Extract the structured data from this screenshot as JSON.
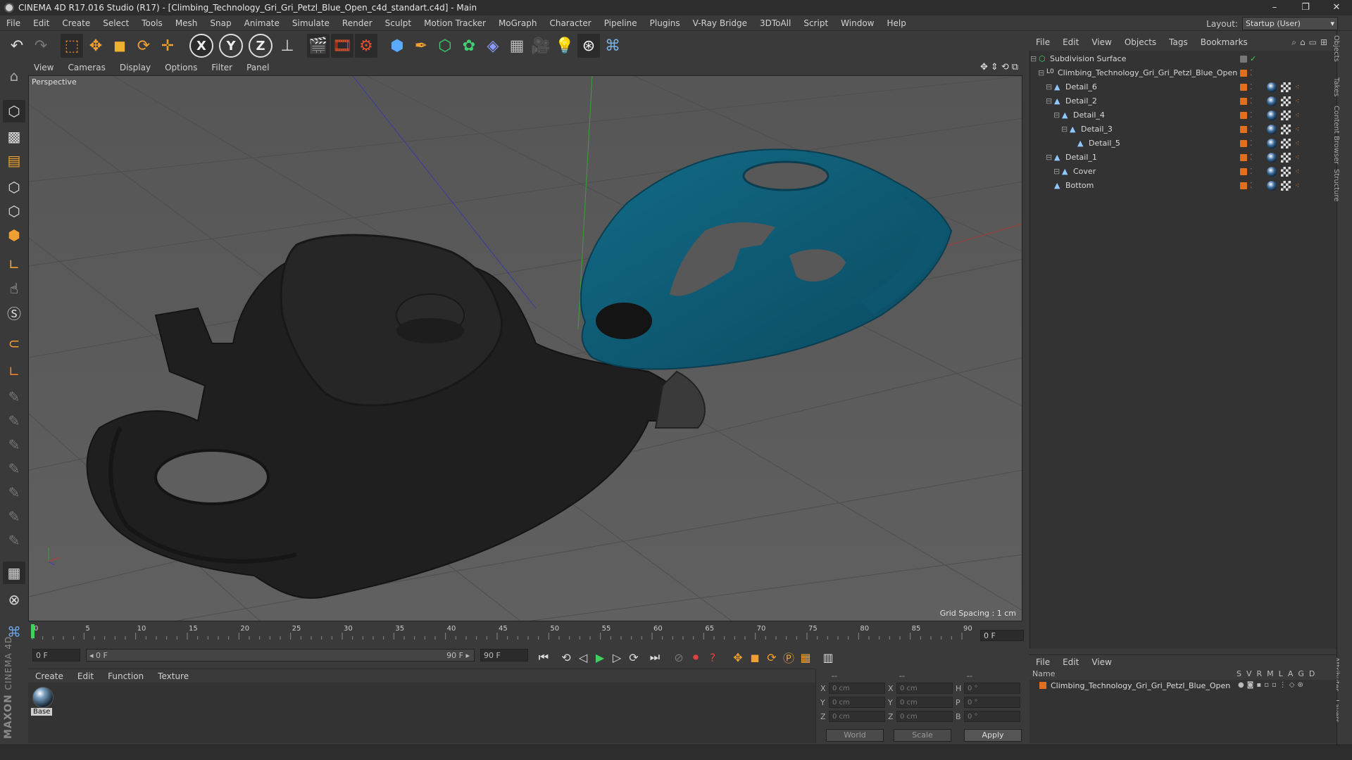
{
  "window": {
    "title": "CINEMA 4D R17.016 Studio (R17) - [Climbing_Technology_Gri_Gri_Petzl_Blue_Open_c4d_standart.c4d] - Main",
    "minimize": "–",
    "restore": "❐",
    "close": "✕"
  },
  "menu": [
    "File",
    "Edit",
    "Create",
    "Select",
    "Tools",
    "Mesh",
    "Snap",
    "Animate",
    "Simulate",
    "Render",
    "Sculpt",
    "Motion Tracker",
    "MoGraph",
    "Character",
    "Pipeline",
    "Plugins",
    "V-Ray Bridge",
    "3DToAll",
    "Script",
    "Window",
    "Help"
  ],
  "layout": {
    "label": "Layout:",
    "value": "Startup (User)"
  },
  "toolbar": {
    "x_label": "X",
    "y_label": "Y",
    "z_label": "Z"
  },
  "viewport": {
    "menu": [
      "View",
      "Cameras",
      "Display",
      "Options",
      "Filter",
      "Panel"
    ],
    "label": "Perspective",
    "grid_spacing": "Grid Spacing : 1 cm",
    "nav_icons": "✥⇕⟲⧉"
  },
  "timeline": {
    "ticks": [
      "0",
      "5",
      "10",
      "15",
      "20",
      "25",
      "30",
      "35",
      "40",
      "45",
      "50",
      "55",
      "60",
      "65",
      "70",
      "75",
      "80",
      "85",
      "90"
    ],
    "end_frame_box": "0 F"
  },
  "playback": {
    "start_field": "0 F",
    "range_start": "◂ 0 F",
    "range_end": "90 F ▸",
    "end_field": "90 F"
  },
  "material_manager": {
    "menu": [
      "Create",
      "Edit",
      "Function",
      "Texture"
    ],
    "material_name": "Base"
  },
  "maxon": {
    "brand": "MAXON",
    "product": "CINEMA 4D"
  },
  "coordinates": {
    "header_left": "--",
    "header_mid": "--",
    "header_right": "--",
    "rows": [
      {
        "a": "X",
        "av": "0 cm",
        "b": "X",
        "bv": "0 cm",
        "c": "H",
        "cv": "0 °"
      },
      {
        "a": "Y",
        "av": "0 cm",
        "b": "Y",
        "bv": "0 cm",
        "c": "P",
        "cv": "0 °"
      },
      {
        "a": "Z",
        "av": "0 cm",
        "b": "Z",
        "bv": "0 cm",
        "c": "B",
        "cv": "0 °"
      }
    ],
    "world": "World",
    "scale": "Scale",
    "apply": "Apply"
  },
  "object_manager": {
    "menu": [
      "File",
      "Edit",
      "View",
      "Objects",
      "Tags",
      "Bookmarks"
    ],
    "objects": [
      {
        "name": "Subdivision Surface",
        "level": 0,
        "icon": "subdivision-icon"
      },
      {
        "name": "Climbing_Technology_Gri_Gri_Petzl_Blue_Open",
        "level": 1,
        "icon": "null-icon"
      },
      {
        "name": "Detail_6",
        "level": 2,
        "icon": "polygon-icon"
      },
      {
        "name": "Detail_2",
        "level": 2,
        "icon": "polygon-icon"
      },
      {
        "name": "Detail_4",
        "level": 3,
        "icon": "polygon-icon"
      },
      {
        "name": "Detail_3",
        "level": 4,
        "icon": "polygon-icon"
      },
      {
        "name": "Detail_5",
        "level": 5,
        "icon": "polygon-icon"
      },
      {
        "name": "Detail_1",
        "level": 2,
        "icon": "polygon-icon"
      },
      {
        "name": "Cover",
        "level": 3,
        "icon": "polygon-icon"
      },
      {
        "name": "Bottom",
        "level": 2,
        "icon": "polygon-icon"
      }
    ]
  },
  "layer_manager": {
    "menu": [
      "File",
      "Edit",
      "View"
    ],
    "header_name": "Name",
    "header_cols": [
      "S",
      "V",
      "R",
      "M",
      "L",
      "A",
      "G",
      "D"
    ],
    "layer_name": "Climbing_Technology_Gri_Gri_Petzl_Blue_Open"
  },
  "right_tabs": [
    "Objects",
    "Takes",
    "Content Browser",
    "Structure"
  ],
  "right_tabs_lower": [
    "Attributes",
    "Layers"
  ],
  "colors": {
    "model_blue": "#0e5a73",
    "model_dark": "#1e1e1e",
    "orange_tag": "#e07020"
  }
}
